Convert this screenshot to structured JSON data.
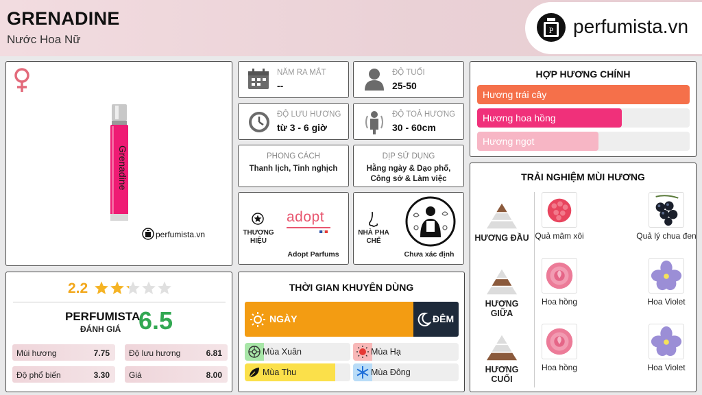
{
  "header": {
    "title": "GRENADINE",
    "subtitle": "Nước Hoa Nữ",
    "brand_logo_text": "perfumista.vn"
  },
  "product": {
    "gender_icon": "female-icon",
    "bottle_label": "Grenadine",
    "watermark": "perfumista.vn"
  },
  "info": {
    "release": {
      "label": "NĂM RA MẮT",
      "value": "--",
      "icon": "calendar-icon"
    },
    "age": {
      "label": "ĐỘ TUỔI",
      "value": "25-50",
      "icon": "person-icon"
    },
    "longevity": {
      "label": "ĐỘ LƯU HƯƠNG",
      "value": "từ 3 - 6 giờ",
      "icon": "clock-icon"
    },
    "sillage": {
      "label": "ĐỘ TOẢ HƯƠNG",
      "value": "30 - 60cm",
      "icon": "sillage-icon"
    },
    "style": {
      "label": "PHONG CÁCH",
      "value": "Thanh lịch, Tinh nghịch"
    },
    "occasion": {
      "label": "DỊP SỬ DỤNG",
      "value": "Hằng ngày & Dạo phố, Công sở & Làm việc"
    },
    "brand": {
      "label_line1": "THƯƠNG",
      "label_line2": "HIỆU",
      "name": "Adopt Parfums",
      "logo_text": "adopt",
      "icon": "star-icon"
    },
    "perfumer": {
      "label_line1": "NHÀ PHA",
      "label_line2": "CHẾ",
      "name": "Chưa xác định",
      "icon": "nose-icon"
    }
  },
  "accords": {
    "title": "HỢP HƯƠNG CHÍNH",
    "items": [
      {
        "label": "Hương trái cây",
        "level": 1.0,
        "color": "#f5704a"
      },
      {
        "label": "Hương hoa hồng",
        "level": 0.68,
        "color": "#f0307a"
      },
      {
        "label": "Hương ngọt",
        "level": 0.57,
        "color": "#f7b6c5"
      }
    ]
  },
  "pyramid": {
    "title": "TRẢI NGHIỆM MÙI HƯƠNG",
    "layers": [
      {
        "label": "HƯƠNG ĐẦU",
        "notes": [
          {
            "name": "Quả mâm xôi",
            "icon": "raspberry-icon"
          },
          {
            "name": "Quả lý chua đen",
            "icon": "blackcurrant-icon"
          }
        ]
      },
      {
        "label": "HƯƠNG GIỮA",
        "notes": [
          {
            "name": "Hoa hồng",
            "icon": "rose-icon"
          },
          {
            "name": "Hoa Violet",
            "icon": "violet-icon"
          }
        ]
      },
      {
        "label": "HƯƠNG CUỐI",
        "notes": [
          {
            "name": "Hoa hồng",
            "icon": "rose-icon"
          },
          {
            "name": "Hoa Violet",
            "icon": "violet-icon"
          }
        ]
      }
    ]
  },
  "rating": {
    "user_score": "2.2",
    "stars": 2.2,
    "brand": "PERFUMISTA",
    "sub": "ĐÁNH GIÁ",
    "score": "6.5",
    "criteria": [
      {
        "name": "Mùi hương",
        "value": "7.75"
      },
      {
        "name": "Độ lưu hương",
        "value": "6.81"
      },
      {
        "name": "Độ phổ biến",
        "value": "3.30"
      },
      {
        "name": "Giá",
        "value": "8.00"
      }
    ]
  },
  "time": {
    "title": "THỜI GIAN KHUYÊN DÙNG",
    "day": "NGÀY",
    "night": "ĐÊM",
    "day_fraction": 0.79,
    "seasons": [
      {
        "name": "Mùa Xuân",
        "level": 0.18,
        "color": "#a8e6a8",
        "icon": "spring-icon"
      },
      {
        "name": "Mùa Hạ",
        "level": 0.18,
        "color": "#f8b8b8",
        "icon": "summer-icon"
      },
      {
        "name": "Mùa Thu",
        "level": 0.86,
        "color": "#fbe04a",
        "icon": "autumn-leaf-icon"
      },
      {
        "name": "Mùa Đông",
        "level": 0.18,
        "color": "#b9dcf7",
        "icon": "snowflake-icon"
      }
    ]
  }
}
